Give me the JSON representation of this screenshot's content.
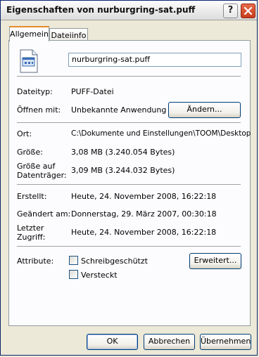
{
  "window": {
    "title": "Eigenschaften von nurburgring-sat.puff",
    "help_glyph": "?"
  },
  "tabs": [
    {
      "label": "Allgemein",
      "active": true
    },
    {
      "label": "Dateiinfo",
      "active": false
    }
  ],
  "file": {
    "name": "nurburgring-sat.puff",
    "icon": "file-icon"
  },
  "details": {
    "type_label": "Dateityp:",
    "type_value": "PUFF-Datei",
    "opens_label": "Öffnen mit:",
    "opens_value": "Unbekannte Anwendung",
    "change_button": "Ändern...",
    "location_label": "Ort:",
    "location_value": "C:\\Dokumente und Einstellungen\\TOOM\\Desktop",
    "size_label": "Größe:",
    "size_value": "3,08 MB (3.240.054 Bytes)",
    "disk_size_label_1": "Größe auf",
    "disk_size_label_2": "Datenträger:",
    "disk_size_value": "3,09 MB (3.244.032 Bytes)",
    "created_label": "Erstellt:",
    "created_value": "Heute, 24. November 2008, 16:22:18",
    "modified_label": "Geändert am:",
    "modified_value": "Donnerstag, 29. März 2007, 00:30:18",
    "accessed_label_1": "Letzter",
    "accessed_label_2": "Zugriff:",
    "accessed_value": "Heute, 24. November 2008, 16:22:18"
  },
  "attributes": {
    "label": "Attribute:",
    "readonly": {
      "label": "Schreibgeschützt",
      "checked": false
    },
    "hidden": {
      "label": "Versteckt",
      "checked": false
    },
    "advanced_button": "Erweitert..."
  },
  "footer": {
    "ok": "OK",
    "cancel": "Abbrechen",
    "apply": "Übernehmen"
  },
  "colors": {
    "tab_accent": "#e68b2c",
    "close_button": "#c63b1b",
    "dialog_background": "#ece9d8"
  }
}
